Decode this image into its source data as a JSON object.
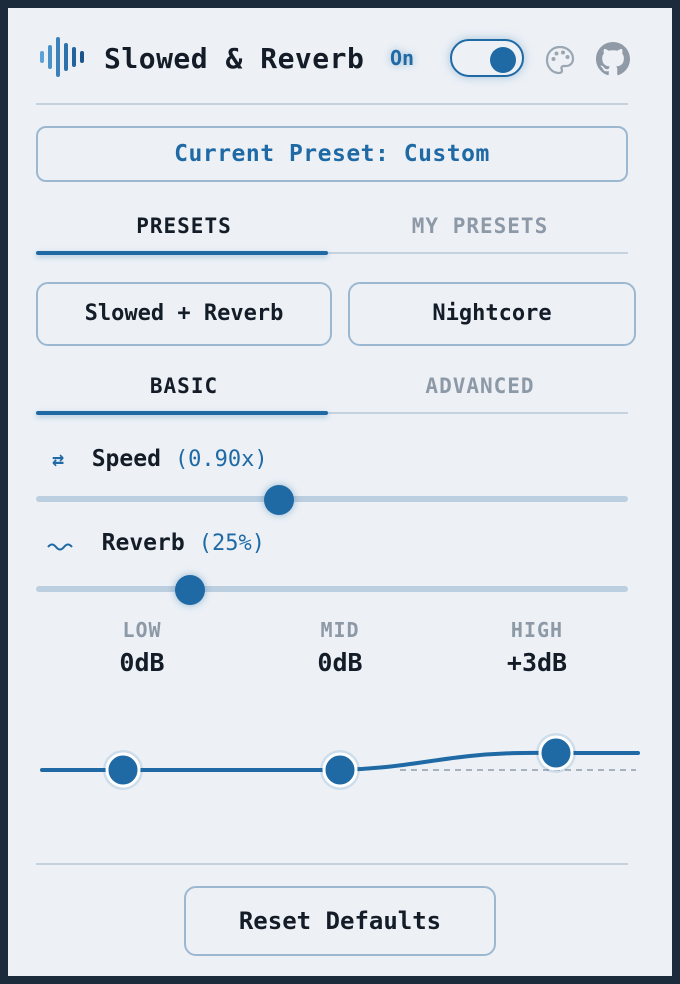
{
  "header": {
    "title": "Slowed & Reverb",
    "status": "On",
    "toggle_on": true
  },
  "preset": {
    "current_label": "Current Preset: Custom"
  },
  "preset_tabs": [
    {
      "label": "PRESETS",
      "active": true
    },
    {
      "label": "MY PRESETS",
      "active": false
    }
  ],
  "preset_buttons": [
    "Slowed + Reverb",
    "Nightcore"
  ],
  "mode_tabs": [
    {
      "label": "BASIC",
      "active": true
    },
    {
      "label": "ADVANCED",
      "active": false
    }
  ],
  "speed": {
    "icon": "swap-arrows-icon",
    "label": "Speed",
    "value_text": "(0.90x)",
    "fraction": 0.41
  },
  "reverb": {
    "icon": "wave-icon",
    "label": "Reverb",
    "value_text": "(25%)",
    "fraction": 0.26
  },
  "eq": {
    "bands": [
      {
        "label": "LOW",
        "value": "0dB",
        "db": 0
      },
      {
        "label": "MID",
        "value": "0dB",
        "db": 0
      },
      {
        "label": "HIGH",
        "value": "+3dB",
        "db": 3
      }
    ]
  },
  "footer": {
    "reset_label": "Reset Defaults"
  },
  "colors": {
    "accent": "#1f6aa5",
    "background": "#edf1f6",
    "frame": "#1b2b3b",
    "border": "#9cb8d0"
  }
}
